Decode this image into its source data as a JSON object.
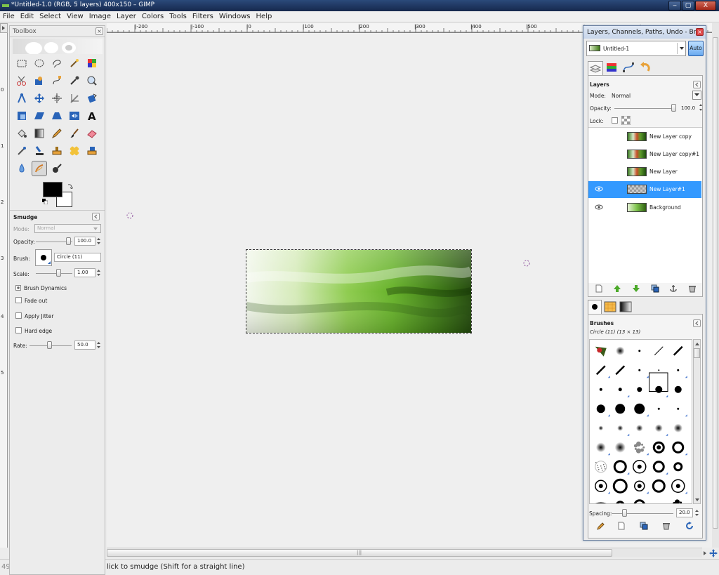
{
  "window": {
    "title": "*Untitled-1.0 (RGB, 5 layers) 400x150 – GIMP",
    "minimize": "‒",
    "maximize": "▢",
    "close": "X"
  },
  "menu": [
    "File",
    "Edit",
    "Select",
    "View",
    "Image",
    "Layer",
    "Colors",
    "Tools",
    "Filters",
    "Windows",
    "Help"
  ],
  "ruler": {
    "h_ticks": [
      "|-200",
      "|-100",
      "|0",
      "|100",
      "|200",
      "|300",
      "|400",
      "|500"
    ],
    "v_ticks": [
      "0",
      "1",
      "2",
      "3",
      "4",
      "5"
    ]
  },
  "toolbox": {
    "title": "Toolbox",
    "close": "×",
    "tool_options": {
      "title": "Smudge",
      "mode_label": "Mode:",
      "mode_value": "Normal",
      "opacity_label": "Opacity:",
      "opacity_value": "100.0",
      "opacity_fraction": 1.0,
      "brush_label": "Brush:",
      "brush_value": "Circle (11)",
      "scale_label": "Scale:",
      "scale_value": "1.00",
      "brush_dynamics": "Brush Dynamics",
      "fade_out": "Fade out",
      "apply_jitter": "Apply Jitter",
      "hard_edge": "Hard edge",
      "rate_label": "Rate:",
      "rate_value": "50.0",
      "rate_fraction": 0.5
    }
  },
  "dock": {
    "title": "Layers, Channels, Paths, Undo - Br...",
    "close": "×",
    "image_select": "Untitled-1",
    "auto_button": "Auto",
    "layers": {
      "title": "Layers",
      "mode_label": "Mode:",
      "mode_value": "Normal",
      "opacity_label": "Opacity:",
      "opacity_value": "100.0",
      "opacity_fraction": 1.0,
      "lock_label": "Lock:",
      "items": [
        {
          "name": "New Layer copy",
          "visible": false,
          "selected": false
        },
        {
          "name": "New Layer copy#1",
          "visible": false,
          "selected": false
        },
        {
          "name": "New Layer",
          "visible": false,
          "selected": false
        },
        {
          "name": "New Layer#1",
          "visible": true,
          "selected": true
        },
        {
          "name": "Background",
          "visible": true,
          "selected": false
        }
      ]
    },
    "brushes": {
      "title": "Brushes",
      "current": "Circle (11) (13 × 13)",
      "spacing_label": "Spacing:",
      "spacing_value": "20.0",
      "spacing_fraction": 0.2
    }
  },
  "statusbar": {
    "message": "lick to smudge (Shift for a straight line)",
    "left_value": "49"
  },
  "colors": {
    "selection": "#3399ff",
    "titlebar": "#1f3865",
    "image_green": "#6ab52a"
  }
}
